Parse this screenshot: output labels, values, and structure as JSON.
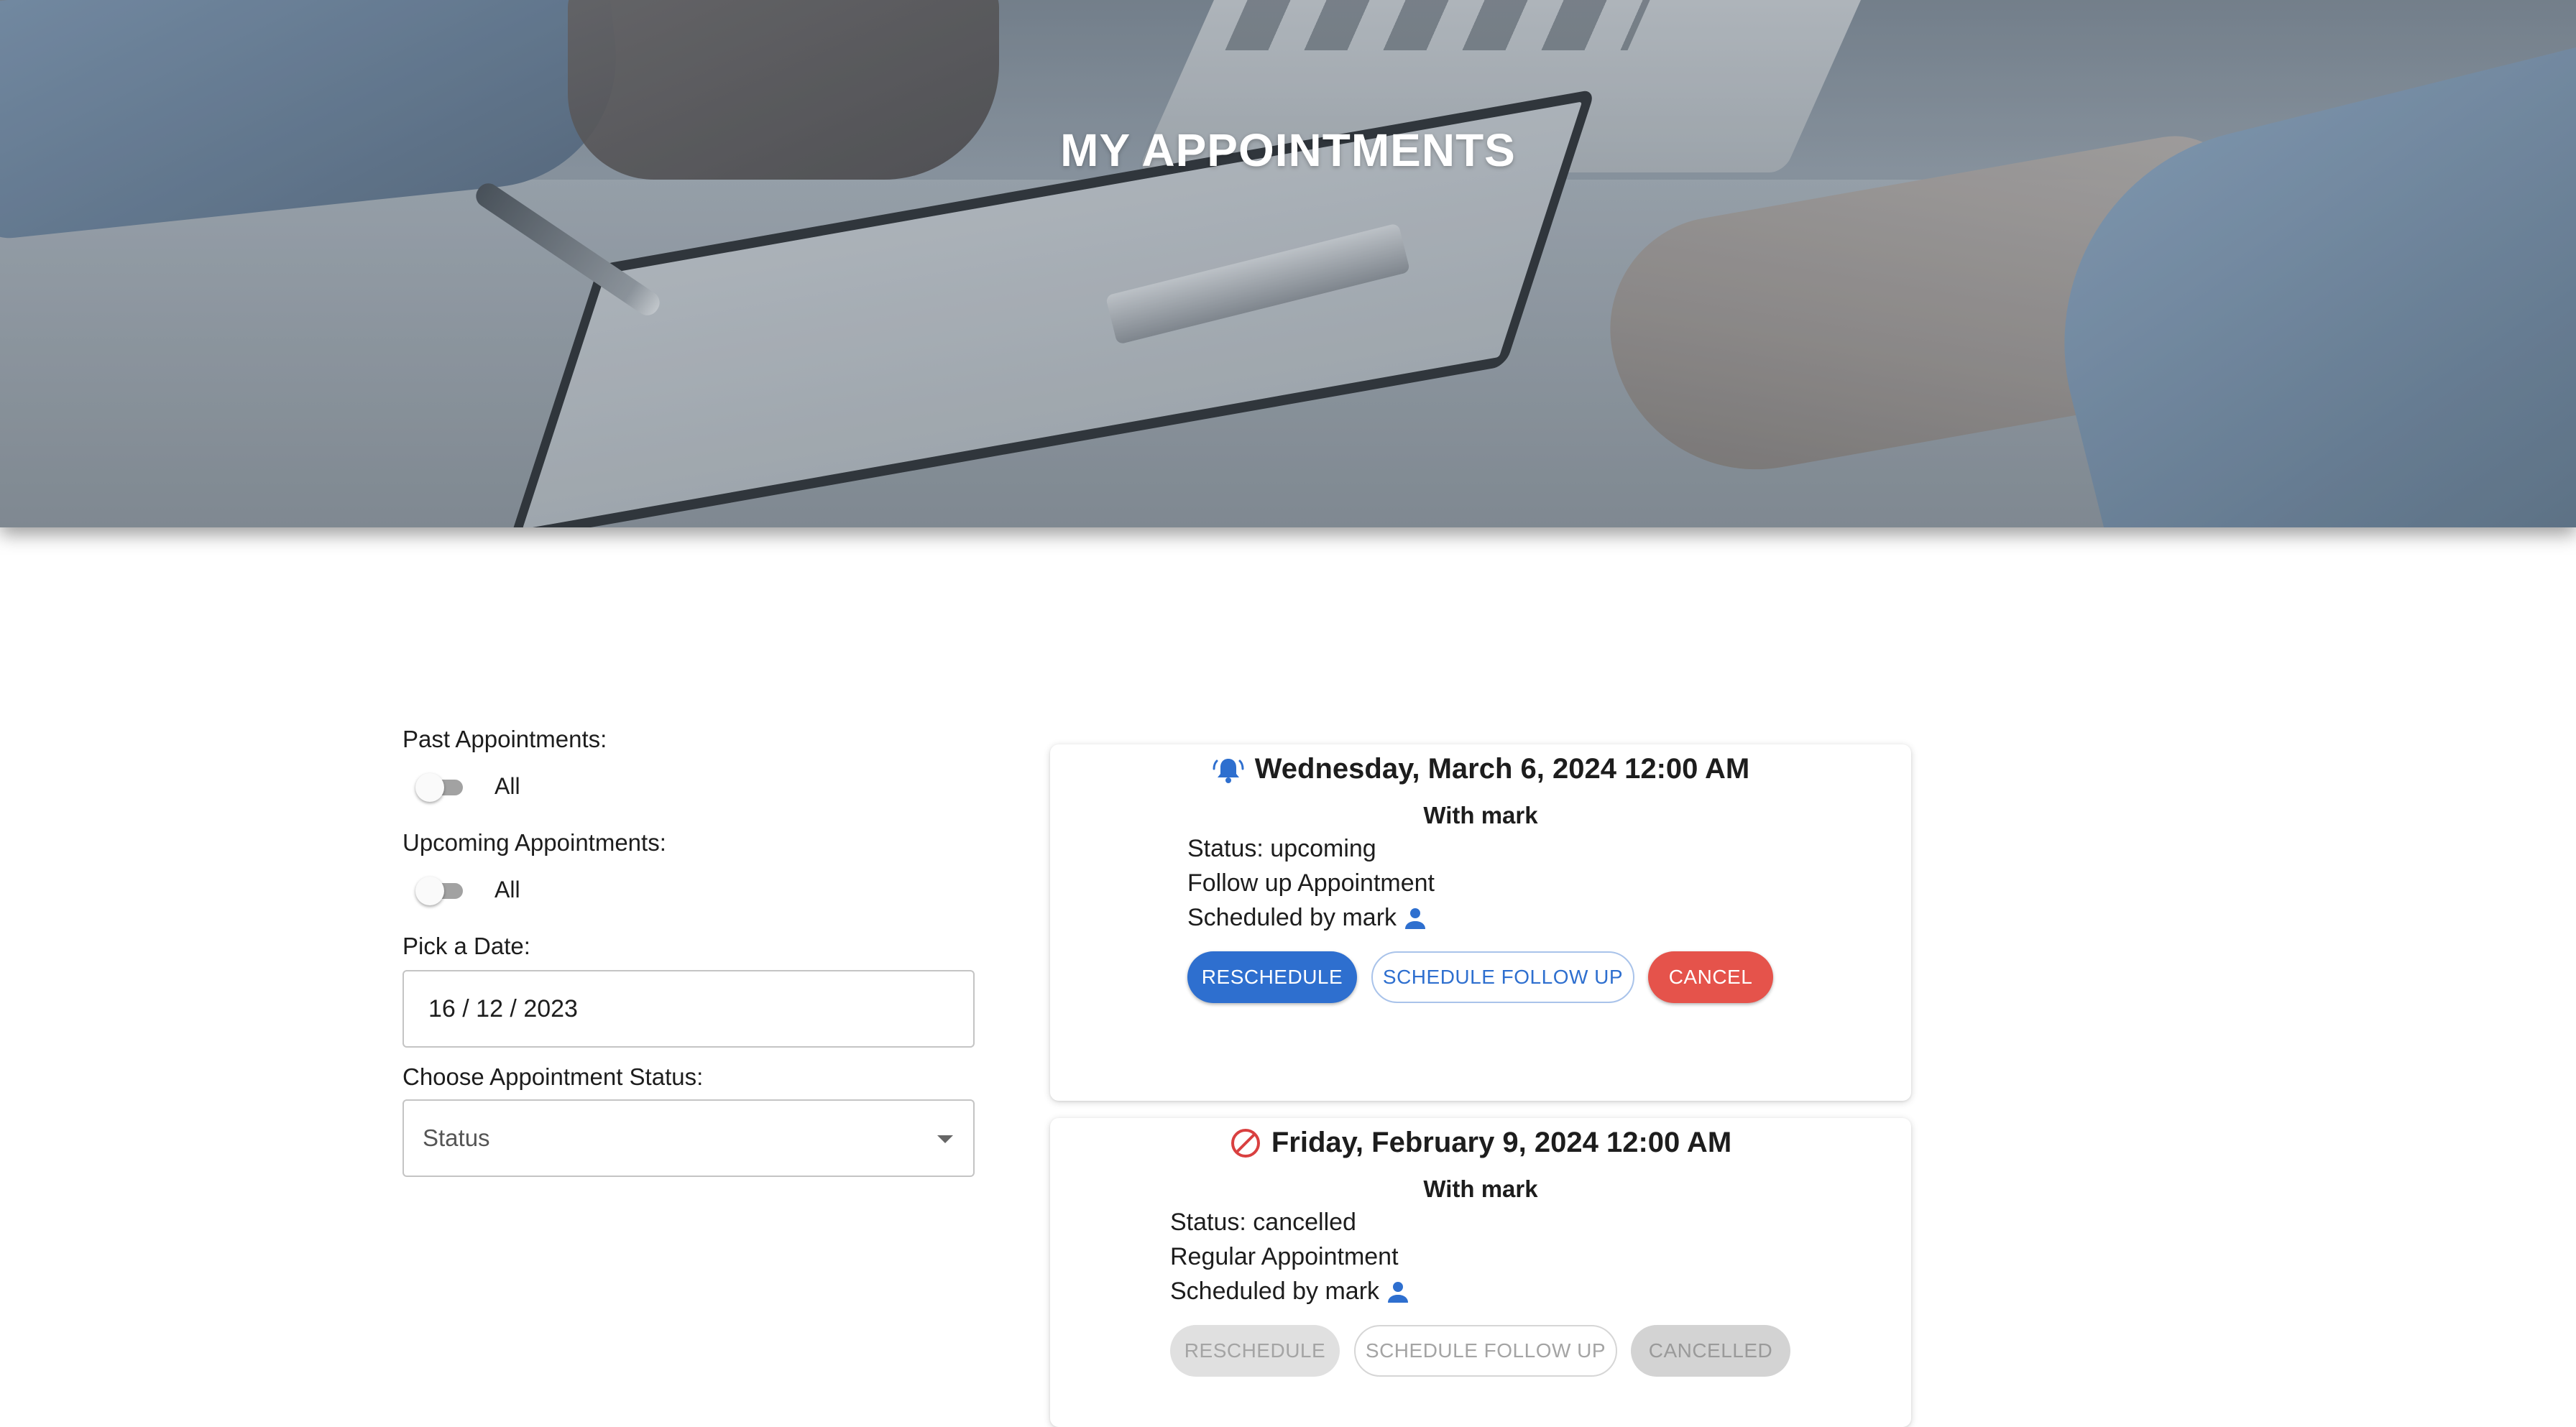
{
  "header": {
    "title": "MY APPOINTMENTS"
  },
  "filters": {
    "past_label": "Past Appointments:",
    "past_toggle_text": "All",
    "upcoming_label": "Upcoming Appointments:",
    "upcoming_toggle_text": "All",
    "date_label": "Pick a Date:",
    "date_value": "16 / 12 / 2023",
    "status_label": "Choose Appointment Status:",
    "status_value": "Status"
  },
  "appointments": [
    {
      "date": "Wednesday, March 6, 2024 12:00 AM",
      "icon": "bell-ringing-icon",
      "with": "With mark",
      "status": "Status: upcoming",
      "type": "Follow up Appointment",
      "scheduled_by": "Scheduled by mark",
      "buttons": {
        "reschedule": "RESCHEDULE",
        "follow_up": "SCHEDULE FOLLOW UP",
        "cancel": "CANCEL"
      }
    },
    {
      "date": "Friday, February 9, 2024 12:00 AM",
      "icon": "cancelled-icon",
      "with": "With mark",
      "status": "Status: cancelled",
      "type": "Regular Appointment",
      "scheduled_by": "Scheduled by mark",
      "buttons": {
        "reschedule": "RESCHEDULE",
        "follow_up": "SCHEDULE FOLLOW UP",
        "cancel": "CANCELLED"
      }
    }
  ],
  "colors": {
    "primary": "#2e6fcf",
    "danger": "#e5534b",
    "cancel_icon": "#d94040",
    "disabled_bg": "#e0e0e0"
  }
}
